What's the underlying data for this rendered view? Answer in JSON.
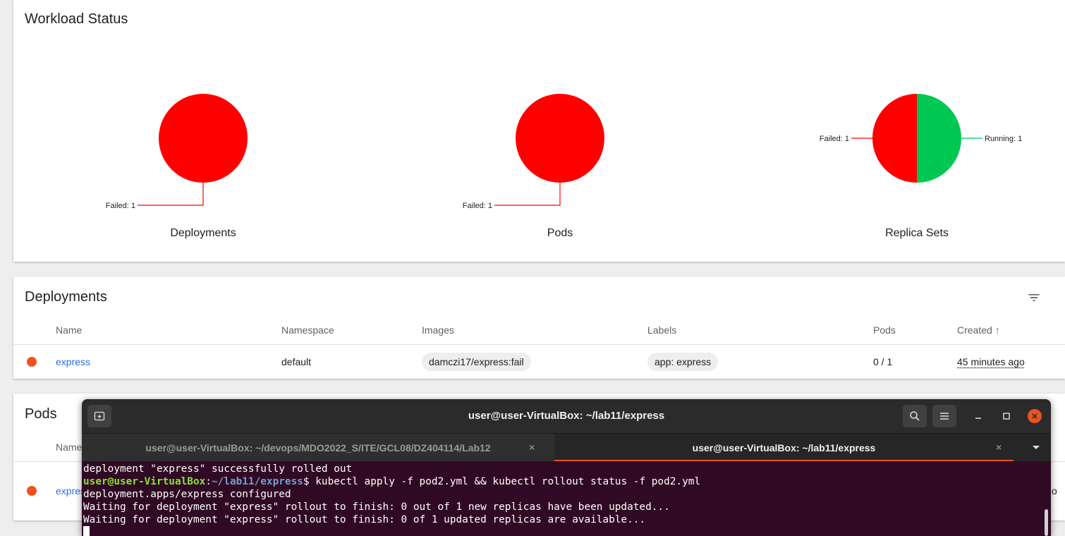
{
  "workload": {
    "title": "Workload Status",
    "charts": [
      {
        "caption": "Deployments",
        "labels": [
          "Failed: 1"
        ]
      },
      {
        "caption": "Pods",
        "labels": [
          "Failed: 1"
        ]
      },
      {
        "caption": "Replica Sets",
        "labels": [
          "Failed: 1",
          "Running: 1"
        ]
      }
    ]
  },
  "chart_data": [
    {
      "type": "pie",
      "title": "Deployments",
      "labels": [
        "Failed"
      ],
      "values": [
        1
      ],
      "colors": [
        "#ff0000"
      ]
    },
    {
      "type": "pie",
      "title": "Pods",
      "labels": [
        "Failed"
      ],
      "values": [
        1
      ],
      "colors": [
        "#ff0000"
      ]
    },
    {
      "type": "pie",
      "title": "Replica Sets",
      "labels": [
        "Failed",
        "Running"
      ],
      "values": [
        1,
        1
      ],
      "colors": [
        "#ff0000",
        "#00c853"
      ]
    }
  ],
  "deployments": {
    "title": "Deployments",
    "filter_icon": "filter-list-icon",
    "columns": [
      "Name",
      "Namespace",
      "Images",
      "Labels",
      "Pods",
      "Created ↑"
    ],
    "rows": [
      {
        "status": "failed",
        "name": "express",
        "namespace": "default",
        "image": "damczi17/express:fail",
        "label": "app: express",
        "pods": "0 / 1",
        "created": "45 minutes ago"
      }
    ]
  },
  "pods": {
    "title": "Pods",
    "col_name_partial": "Name",
    "row_name_partial": "expres",
    "right_edge_partial": "o"
  },
  "terminal": {
    "title": "user@user-VirtualBox: ~/lab11/express",
    "tabs": [
      {
        "label": "user@user-VirtualBox: ~/devops/MDO2022_S/ITE/GCL08/DZ404114/Lab12",
        "active": false
      },
      {
        "label": "user@user-VirtualBox: ~/lab11/express",
        "active": true
      }
    ],
    "lines": {
      "l1": "deployment \"express\" successfully rolled out",
      "prompt_user": "user@user-VirtualBox",
      "prompt_colon": ":",
      "prompt_path": "~/lab11/express",
      "prompt_cmd": "$ kubectl apply -f pod2.yml && kubectl rollout status -f pod2.yml",
      "l3": "deployment.apps/express configured",
      "l4": "Waiting for deployment \"express\" rollout to finish: 0 out of 1 new replicas have been updated...",
      "l5": "Waiting for deployment \"express\" rollout to finish: 0 of 1 updated replicas are available..."
    },
    "close_glyph": "×"
  },
  "colors": {
    "failed": "#ff0000",
    "running": "#00c853",
    "status_dot": "#f4511e",
    "link": "#326de6",
    "terminal_bg": "#300a24",
    "ubuntu_orange": "#e95420"
  }
}
